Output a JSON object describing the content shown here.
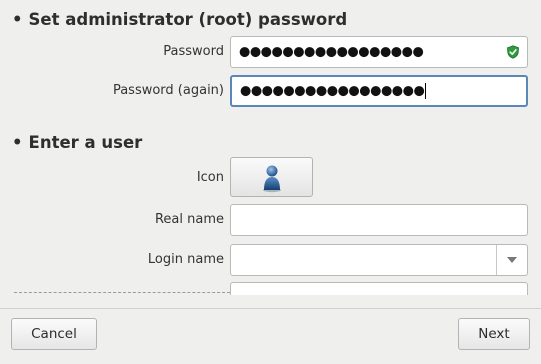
{
  "root_section": {
    "bullet": "•",
    "title": "Set administrator (root) password",
    "password_label": "Password",
    "password_value": "●●●●●●●●●●●●●●●●●",
    "password_again_label": "Password (again)",
    "password_again_value": "●●●●●●●●●●●●●●●●●",
    "strength_icon": "shield-check-icon",
    "strength_color": "#2e9b3e"
  },
  "user_section": {
    "bullet": "•",
    "title": "Enter a user",
    "icon_label": "Icon",
    "user_icon": "user-avatar-icon",
    "real_name_label": "Real name",
    "real_name_value": "",
    "login_name_label": "Login name",
    "login_name_value": ""
  },
  "footer": {
    "cancel_label": "Cancel",
    "next_label": "Next"
  }
}
